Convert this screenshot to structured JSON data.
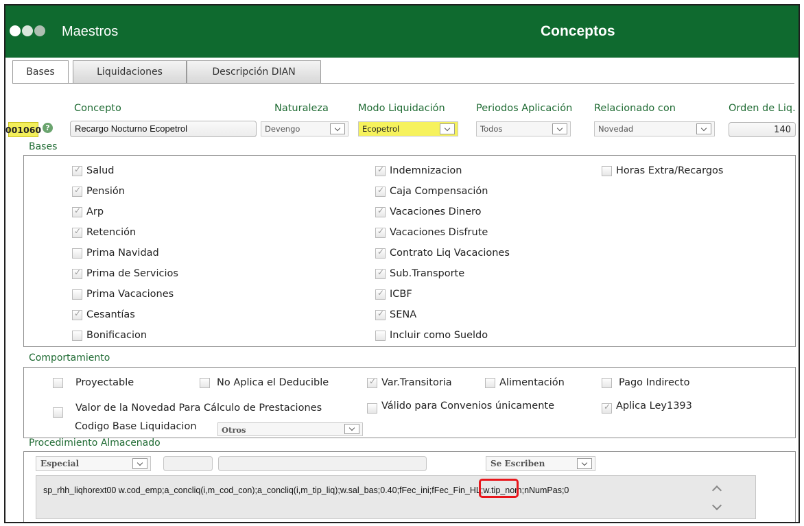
{
  "header": {
    "app_title": "Maestros",
    "screen_title": "Conceptos",
    "brand_color": "#0f6a2f"
  },
  "tabs": [
    {
      "label": "Bases",
      "active": true
    },
    {
      "label": "Liquidaciones",
      "active": false
    },
    {
      "label": "Descripción DIAN",
      "active": false
    }
  ],
  "fields": {
    "concepto_label": "Concepto",
    "concepto_code": "001060",
    "concepto_help_icon": "help-icon",
    "concepto_value": "Recargo Nocturno Ecopetrol",
    "naturaleza_label": "Naturaleza",
    "naturaleza_value": "Devengo",
    "modo_label": "Modo Liquidación",
    "modo_value": "Ecopetrol",
    "periodos_label": "Periodos Aplicación",
    "periodos_value": "Todos",
    "relacionado_label": "Relacionado con",
    "relacionado_value": "Novedad",
    "orden_label": "Orden de Liq.",
    "orden_value": "140"
  },
  "bases": {
    "title": "Bases",
    "col1": [
      {
        "label": "Salud",
        "checked": true
      },
      {
        "label": "Pensión",
        "checked": true
      },
      {
        "label": "Arp",
        "checked": true
      },
      {
        "label": "Retención",
        "checked": true
      },
      {
        "label": "Prima Navidad",
        "checked": false
      },
      {
        "label": "Prima de Servicios",
        "checked": true
      },
      {
        "label": "Prima Vacaciones",
        "checked": false
      },
      {
        "label": "Cesantías",
        "checked": true
      },
      {
        "label": "Bonificacion",
        "checked": false
      }
    ],
    "col2": [
      {
        "label": "Indemnizacion",
        "checked": true
      },
      {
        "label": "Caja Compensación",
        "checked": true
      },
      {
        "label": "Vacaciones Dinero",
        "checked": true
      },
      {
        "label": "Vacaciones Disfrute",
        "checked": true
      },
      {
        "label": "Contrato Liq Vacaciones",
        "checked": true
      },
      {
        "label": "Sub.Transporte",
        "checked": true
      },
      {
        "label": "ICBF",
        "checked": true
      },
      {
        "label": "SENA",
        "checked": true
      },
      {
        "label": "Incluir como Sueldo",
        "checked": false
      }
    ],
    "col3": [
      {
        "label": "Horas Extra/Recargos",
        "checked": false
      }
    ]
  },
  "comportamiento": {
    "title": "Comportamiento",
    "row1": [
      {
        "label": "Proyectable",
        "checked": false
      },
      {
        "label": "No Aplica el Deducible",
        "checked": false
      },
      {
        "label": "Var.Transitoria",
        "checked": true
      },
      {
        "label": "Alimentación",
        "checked": false
      },
      {
        "label": "Pago Indirecto",
        "checked": false
      }
    ],
    "row2": [
      {
        "label": "Valor de la Novedad Para Cálculo de Prestaciones",
        "checked": false
      },
      {
        "label": "Válido para Convenios únicamente",
        "checked": false
      },
      {
        "label": "Aplica Ley1393",
        "checked": true
      }
    ],
    "codigo_base_label": "Codigo Base Liquidacion",
    "codigo_base_value": "Otros"
  },
  "procedimiento": {
    "title": "Procedimiento Almacenado",
    "tipo_value": "Especial",
    "escritura_value": "Se Escriben",
    "text": "sp_rhh_liqhorext00 w.cod_emp;a_concliq(i,m_cod_con);a_concliq(i,m_tip_liq);w.sal_bas;0.40;fFec_ini;fFec_Fin_HL;w.tip_nom;nNumPas;0",
    "highlight_color": "#e8161b"
  }
}
